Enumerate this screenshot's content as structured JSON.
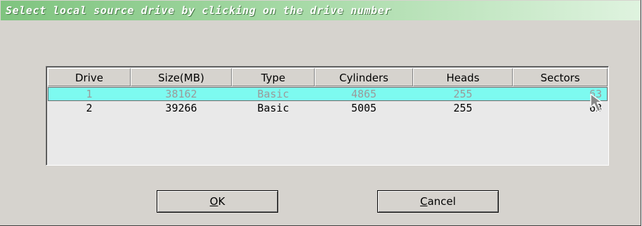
{
  "dialog": {
    "title": "Select local source drive by clicking on the drive number"
  },
  "table": {
    "columns": [
      "Drive",
      "Size(MB)",
      "Type",
      "Cylinders",
      "Heads",
      "Sectors"
    ],
    "rows": [
      {
        "drive": "1",
        "size": "38162",
        "type": "Basic",
        "cylinders": "4865",
        "heads": "255",
        "sectors": "63",
        "selected": true
      },
      {
        "drive": "2",
        "size": "39266",
        "type": "Basic",
        "cylinders": "5005",
        "heads": "255",
        "sectors": "63",
        "selected": false
      }
    ]
  },
  "buttons": {
    "ok": {
      "mnemonic": "O",
      "rest": "K"
    },
    "cancel": {
      "mnemonic": "C",
      "rest": "ancel"
    }
  },
  "colors": {
    "title_gradient_start": "#7fc47f",
    "selected_row": "#7dfaf0",
    "dialog_bg": "#d6d3ce"
  },
  "icons": {
    "pointer": "arrow-cursor-icon"
  }
}
